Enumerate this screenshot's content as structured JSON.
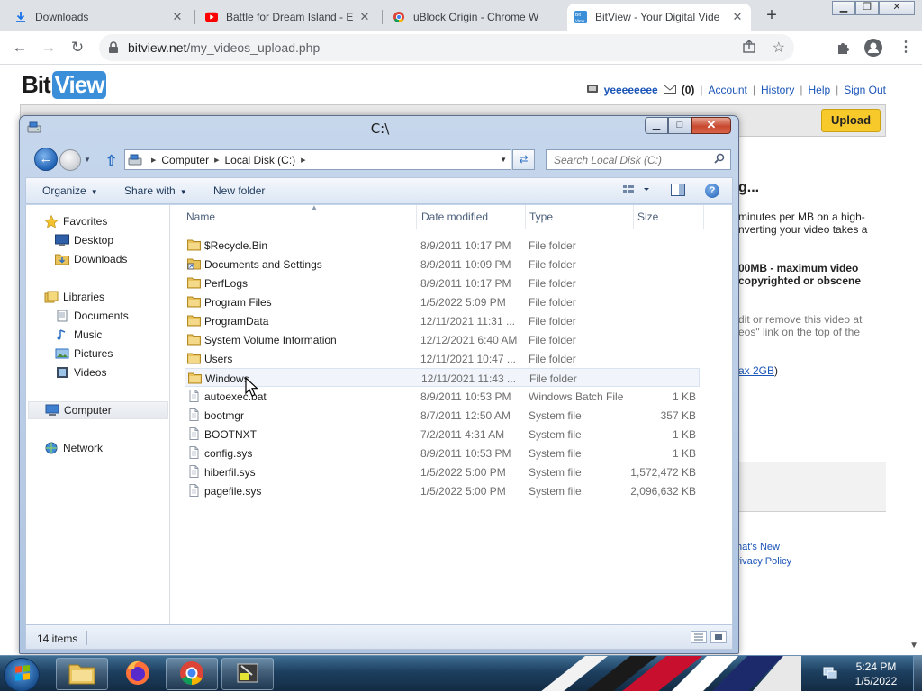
{
  "browser": {
    "tabs": [
      {
        "title": "Downloads"
      },
      {
        "title": "Battle for Dream Island - E"
      },
      {
        "title": "uBlock Origin - Chrome W"
      },
      {
        "title": "BitView - Your Digital Vide"
      }
    ],
    "url_domain": "bitview.net",
    "url_path": "/my_videos_upload.php"
  },
  "bitview": {
    "logo_bit": "Bit",
    "logo_view": "View",
    "username": "yeeeeeeee",
    "inbox_count": "(0)",
    "nav_links": [
      "Account",
      "History",
      "Help",
      "Sign Out"
    ],
    "upload_button": "Upload",
    "heading_fragment": "g...",
    "text_lines": [
      "minutes per MB on a high-",
      "nverting your video takes a"
    ],
    "bold_lines": [
      "00MB - maximum video",
      " copyrighted or obscene"
    ],
    "gray_lines": [
      "dit or remove this video at",
      "eos\" link on the top of the"
    ],
    "max_link": "ax 2GB",
    "footer_links": [
      "hat's New",
      "rivacy Policy"
    ]
  },
  "explorer": {
    "title": "C:\\",
    "breadcrumb": [
      "Computer",
      "Local Disk (C:)"
    ],
    "search_placeholder": "Search Local Disk (C:)",
    "commands": {
      "organize": "Organize",
      "share_with": "Share with",
      "new_folder": "New folder"
    },
    "nav": {
      "favorites": "Favorites",
      "favorites_items": [
        "Desktop",
        "Downloads"
      ],
      "libraries": "Libraries",
      "libraries_items": [
        "Documents",
        "Music",
        "Pictures",
        "Videos"
      ],
      "computer": "Computer",
      "network": "Network"
    },
    "columns": {
      "name": "Name",
      "date": "Date modified",
      "type": "Type",
      "size": "Size"
    },
    "files": [
      {
        "name": "$Recycle.Bin",
        "date": "8/9/2011 10:17 PM",
        "type": "File folder",
        "size": "",
        "icon": "folder"
      },
      {
        "name": "Documents and Settings",
        "date": "8/9/2011 10:09 PM",
        "type": "File folder",
        "size": "",
        "icon": "shortcut-folder"
      },
      {
        "name": "PerfLogs",
        "date": "8/9/2011 10:17 PM",
        "type": "File folder",
        "size": "",
        "icon": "folder"
      },
      {
        "name": "Program Files",
        "date": "1/5/2022 5:09 PM",
        "type": "File folder",
        "size": "",
        "icon": "folder"
      },
      {
        "name": "ProgramData",
        "date": "12/11/2021 11:31 ...",
        "type": "File folder",
        "size": "",
        "icon": "folder"
      },
      {
        "name": "System Volume Information",
        "date": "12/12/2021 6:40 AM",
        "type": "File folder",
        "size": "",
        "icon": "folder"
      },
      {
        "name": "Users",
        "date": "12/11/2021 10:47 ...",
        "type": "File folder",
        "size": "",
        "icon": "folder"
      },
      {
        "name": "Windows",
        "date": "12/11/2021 11:43 ...",
        "type": "File folder",
        "size": "",
        "icon": "folder"
      },
      {
        "name": "autoexec.bat",
        "date": "8/9/2011 10:53 PM",
        "type": "Windows Batch File",
        "size": "1 KB",
        "icon": "file"
      },
      {
        "name": "bootmgr",
        "date": "8/7/2011 12:50 AM",
        "type": "System file",
        "size": "357 KB",
        "icon": "file"
      },
      {
        "name": "BOOTNXT",
        "date": "7/2/2011 4:31 AM",
        "type": "System file",
        "size": "1 KB",
        "icon": "file"
      },
      {
        "name": "config.sys",
        "date": "8/9/2011 10:53 PM",
        "type": "System file",
        "size": "1 KB",
        "icon": "file"
      },
      {
        "name": "hiberfil.sys",
        "date": "1/5/2022 5:00 PM",
        "type": "System file",
        "size": "1,572,472 KB",
        "icon": "file"
      },
      {
        "name": "pagefile.sys",
        "date": "1/5/2022 5:00 PM",
        "type": "System file",
        "size": "2,096,632 KB",
        "icon": "file"
      }
    ],
    "status_count": "14 items"
  },
  "taskbar": {
    "time": "5:24 PM",
    "date": "1/5/2022"
  },
  "colors": {
    "chrome_tabstrip": "#dee1e6",
    "bitview_blue": "#3b8fd9",
    "upload_yellow": "#f7c92a",
    "link_blue": "#1a55b8",
    "folder_yellow": "#e8c25a"
  }
}
